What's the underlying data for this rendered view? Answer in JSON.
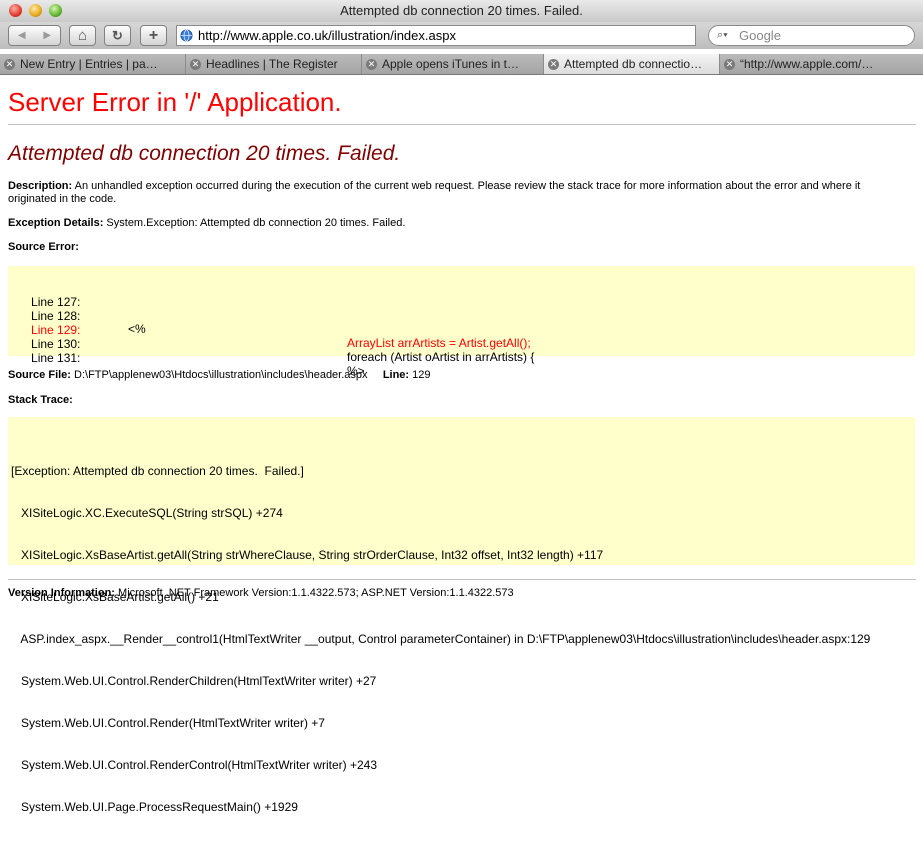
{
  "window": {
    "title": "Attempted db connection 20 times. Failed."
  },
  "toolbar": {
    "back_icon": "◀",
    "forward_icon": "▶",
    "home_icon": "⌂",
    "reload_icon": "↻",
    "add_icon": "+",
    "url": "http://www.apple.co.uk/illustration/index.aspx",
    "search_placeholder": "Google",
    "search_icon": "⌕▾"
  },
  "tabs": [
    {
      "label": "New Entry | Entries | pa…",
      "active": false
    },
    {
      "label": "Headlines | The Register",
      "active": false
    },
    {
      "label": "Apple opens iTunes in t…",
      "active": false
    },
    {
      "label": "Attempted db connectio…",
      "active": true
    },
    {
      "label": "“http://www.apple.com/…",
      "active": false
    }
  ],
  "page": {
    "heading": "Server Error in '/' Application.",
    "subheading": "Attempted db connection 20 times. Failed.",
    "description_label": "Description:",
    "description_text": "An unhandled exception occurred during the execution of the current web request. Please review the stack trace for more information about the error and where it originated in the code.",
    "exception_label": "Exception Details:",
    "exception_text": "System.Exception: Attempted db connection 20 times. Failed.",
    "source_error_label": "Source Error:",
    "source_lines": [
      {
        "line": "Line 127:",
        "code": "",
        "highlight": false
      },
      {
        "line": "Line 128:",
        "code": "<%",
        "highlight": false
      },
      {
        "line": "Line 129:",
        "code": "ArrayList arrArtists = Artist.getAll();",
        "highlight": true
      },
      {
        "line": "Line 130:",
        "code": "foreach (Artist oArtist in arrArtists) {",
        "highlight": false
      },
      {
        "line": "Line 131:",
        "code": "%>",
        "highlight": false
      }
    ],
    "source_file_label": "Source File:",
    "source_file": "D:\\FTP\\applenew03\\Htdocs\\illustration\\includes\\header.aspx",
    "line_label": "Line:",
    "line_number": "129",
    "stack_trace_label": "Stack Trace:",
    "stack_trace": [
      "[Exception: Attempted db connection 20 times.  Failed.]",
      "   XISiteLogic.XC.ExecuteSQL(String strSQL) +274",
      "   XISiteLogic.XsBaseArtist.getAll(String strWhereClause, String strOrderClause, Int32 offset, Int32 length) +117",
      "   XISiteLogic.XsBaseArtist.getAll() +21",
      "   ASP.index_aspx.__Render__control1(HtmlTextWriter __output, Control parameterContainer) in D:\\FTP\\applenew03\\Htdocs\\illustration\\includes\\header.aspx:129",
      "   System.Web.UI.Control.RenderChildren(HtmlTextWriter writer) +27",
      "   System.Web.UI.Control.Render(HtmlTextWriter writer) +7",
      "   System.Web.UI.Control.RenderControl(HtmlTextWriter writer) +243",
      "   System.Web.UI.Page.ProcessRequestMain() +1929"
    ],
    "version_label": "Version Information:",
    "version_text": "Microsoft .NET Framework Version:1.1.4322.573; ASP.NET Version:1.1.4322.573"
  },
  "colors": {
    "error_red": "#ff0000",
    "subheading_maroon": "#800000",
    "code_bg": "#ffffcc"
  }
}
